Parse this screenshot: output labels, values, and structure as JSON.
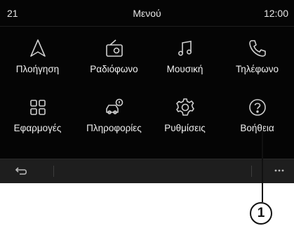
{
  "status": {
    "left": "21",
    "title": "Μενού",
    "time": "12:00"
  },
  "menu": {
    "items": [
      {
        "label": "Πλοήγηση",
        "icon": "navigation-arrow-icon"
      },
      {
        "label": "Ραδιόφωνο",
        "icon": "radio-icon"
      },
      {
        "label": "Μουσική",
        "icon": "music-note-icon"
      },
      {
        "label": "Τηλέφωνο",
        "icon": "phone-icon"
      },
      {
        "label": "Εφαρμογές",
        "icon": "apps-grid-icon"
      },
      {
        "label": "Πληροφορίες",
        "icon": "car-info-icon"
      },
      {
        "label": "Ρυθμίσεις",
        "icon": "settings-gear-icon"
      },
      {
        "label": "Βοήθεια",
        "icon": "help-question-icon"
      }
    ]
  },
  "bottom_bar": {
    "back_icon": "back-arrow-icon",
    "more_icon": "more-dots-icon"
  },
  "callout": {
    "number": "1"
  },
  "colors": {
    "screen_bg": "#050505",
    "bar_bg": "#1e1e1e",
    "icon": "#cfcfcf",
    "text": "#f0f0f0"
  }
}
